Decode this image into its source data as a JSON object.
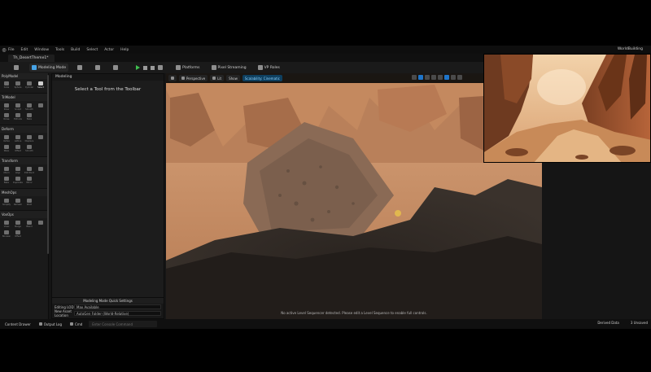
{
  "app": {
    "menu": [
      "File",
      "Edit",
      "Window",
      "Tools",
      "Build",
      "Select",
      "Actor",
      "Help"
    ],
    "project": "WorldBuilding",
    "tab": "Th_DesertTheme1*"
  },
  "toolbar": {
    "mode": "Modeling Mode",
    "platforms": "Platforms",
    "pixel_streaming": "Pixel Streaming",
    "vp_roles": "VP Roles"
  },
  "tool_panel": {
    "header": "PolyModel",
    "sections": [
      {
        "title": "",
        "tools": [
          {
            "label": "Cube",
            "selected": false
          },
          {
            "label": "Sphere",
            "selected": false
          },
          {
            "label": "Cylinder",
            "selected": false
          },
          {
            "label": "Select",
            "selected": true
          }
        ]
      },
      {
        "title": "TriModel",
        "tools": [
          {
            "label": "Draw",
            "selected": false
          },
          {
            "label": "Sculpt",
            "selected": false
          },
          {
            "label": "Smooth",
            "selected": false
          },
          {
            "label": "",
            "selected": false
          },
          {
            "label": "Noise",
            "selected": false
          },
          {
            "label": "Extrude",
            "selected": false
          },
          {
            "label": "Bake",
            "selected": false
          }
        ]
      },
      {
        "title": "Deform",
        "tools": [
          {
            "label": "Vertex",
            "selected": false
          },
          {
            "label": "Lattice",
            "selected": false
          },
          {
            "label": "Displace",
            "selected": false
          },
          {
            "label": "",
            "selected": false
          },
          {
            "label": "Warp",
            "selected": false
          },
          {
            "label": "Offset",
            "selected": false
          },
          {
            "label": "Smooth",
            "selected": false
          }
        ]
      },
      {
        "title": "Transform",
        "tools": [
          {
            "label": "Xform",
            "selected": false
          },
          {
            "label": "Align",
            "selected": false
          },
          {
            "label": "Edit Pivot",
            "selected": false
          },
          {
            "label": "",
            "selected": false
          },
          {
            "label": "Bake",
            "selected": false
          },
          {
            "label": "Duplicate",
            "selected": false
          },
          {
            "label": "Mirror",
            "selected": false
          }
        ]
      },
      {
        "title": "MeshOps",
        "tools": [
          {
            "label": "Simplify",
            "selected": false
          },
          {
            "label": "Remesh",
            "selected": false
          },
          {
            "label": "Weld",
            "selected": false
          }
        ]
      },
      {
        "title": "VoxOps",
        "tools": [
          {
            "label": "Voxel",
            "selected": false
          },
          {
            "label": "Merge",
            "selected": false
          },
          {
            "label": "Blend",
            "selected": false
          },
          {
            "label": "",
            "selected": false
          },
          {
            "label": "Boolean",
            "selected": false
          },
          {
            "label": "Offset",
            "selected": false
          }
        ]
      }
    ]
  },
  "modeling_panel": {
    "tab": "Modeling",
    "title": "Select a Tool from the Toolbar",
    "quick_settings": {
      "title": "Modeling Mode Quick Settings",
      "rows": [
        {
          "key": "Editing LOD",
          "value": "Max Available"
        },
        {
          "key": "New Asset Location",
          "value": "AutoGen Folder (World-Relative)"
        }
      ]
    }
  },
  "viewport": {
    "perspective": "Perspective",
    "lit": "Lit",
    "show": "Show",
    "scalability": "Scalability: Cinematic",
    "message": "No active Level Sequencer detected. Please edit a Level Sequence to enable full controls."
  },
  "statusbar": {
    "content_drawer": "Content Drawer",
    "output_log": "Output Log",
    "cmd": "Cmd",
    "cmd_placeholder": "Enter Console Command",
    "derived_data": "Derived Data",
    "unsaved": "3 Unsaved"
  },
  "colors": {
    "accent_blue": "#1e74c9",
    "play_green": "#3fbf4f",
    "scalability": "#8fd3ff"
  }
}
